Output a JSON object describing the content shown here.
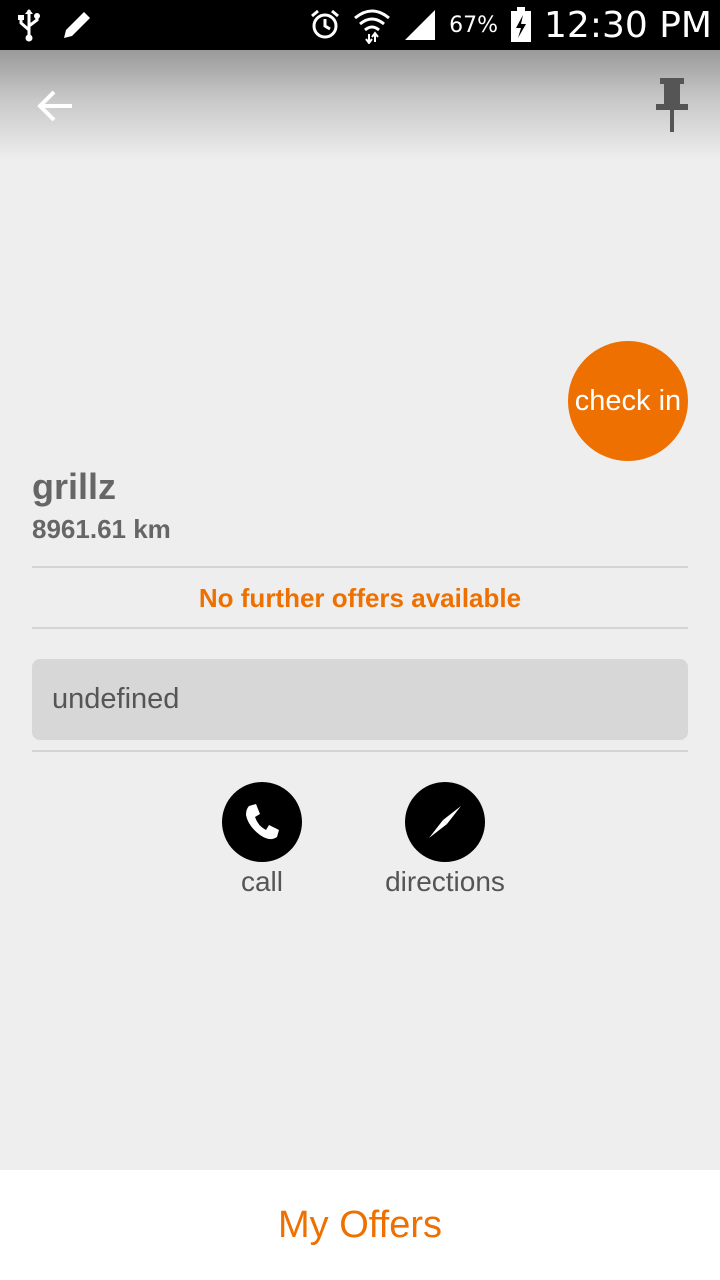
{
  "status_bar": {
    "battery_percent": "67%",
    "time": "12:30 PM",
    "icons": [
      "usb-icon",
      "pencil-icon",
      "alarm-icon",
      "wifi-icon",
      "signal-icon",
      "battery-icon"
    ]
  },
  "app_bar": {
    "back_icon": "arrow-left-icon",
    "pin_icon": "pin-icon"
  },
  "check_in_label": "check in",
  "place": {
    "name": "grillz",
    "distance": "8961.61 km"
  },
  "offers_status": "No further offers available",
  "description": "undefined",
  "actions": {
    "call_label": "call",
    "call_icon": "phone-icon",
    "directions_label": "directions",
    "directions_icon": "compass-icon"
  },
  "bottom_bar": {
    "label": "My Offers"
  },
  "colors": {
    "accent": "#ee7000",
    "background": "#eeeeee",
    "status_bar": "#000000"
  }
}
